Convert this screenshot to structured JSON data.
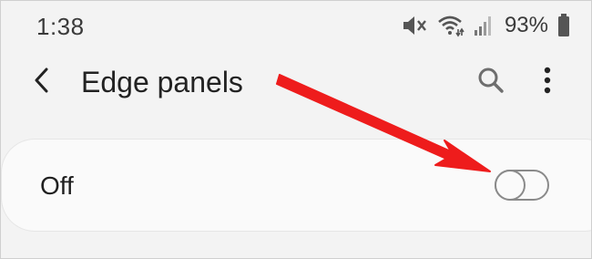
{
  "status_bar": {
    "time": "1:38",
    "battery_percent": "93%",
    "icons": [
      "mute-vibrate-icon",
      "wifi-icon",
      "signal-icon",
      "battery-icon"
    ]
  },
  "app_bar": {
    "title": "Edge panels",
    "icons": [
      "back-arrow-icon",
      "search-icon",
      "more-options-icon"
    ]
  },
  "setting": {
    "label": "Off",
    "toggle_on": false
  },
  "annotation": {
    "arrow_color": "#ee1c1c"
  },
  "colors": {
    "background": "#f3f3f3",
    "card": "#fafafa",
    "toggle_off": "#8a8a8a",
    "icon": "#6e6e6e"
  }
}
